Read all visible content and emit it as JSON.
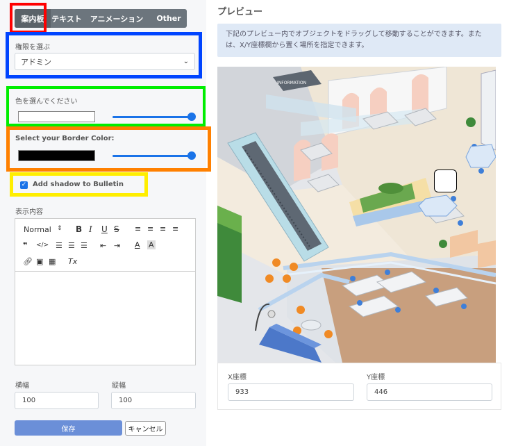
{
  "tabs": [
    {
      "label": "案内板",
      "active": true
    },
    {
      "label": "テキスト",
      "active": false
    },
    {
      "label": "アニメーション",
      "active": false
    },
    {
      "label": "Other",
      "active": false
    }
  ],
  "permission": {
    "label": "権限を選ぶ",
    "value": "アドミン"
  },
  "color": {
    "label": "色を選んでください",
    "value": "#ffffff",
    "slider": 1.0
  },
  "border_color": {
    "label": "Select your Border Color:",
    "value": "#000000",
    "slider": 1.0
  },
  "shadow": {
    "label": "Add shadow to Bulletin",
    "checked": true
  },
  "content": {
    "label": "表示内容",
    "toolbar": {
      "format": "Normal",
      "format_arrow": "⇕",
      "bold": "B",
      "italic": "I",
      "underline": "U",
      "strike": "S",
      "quote": "❞",
      "code": "</>",
      "clear": "Tx"
    },
    "body": ""
  },
  "width": {
    "label": "横幅",
    "value": "100"
  },
  "height": {
    "label": "縦幅",
    "value": "100"
  },
  "save_label": "保存",
  "cancel_label": "キャンセル",
  "preview": {
    "title": "プレビュー",
    "info": "下記のプレビュー内でオブジェクトをドラッグして移動することができます。または、X/Y座標欄から置く場所を指定できます。",
    "sign_text": "INFORMATION"
  },
  "x_coord": {
    "label": "X座標",
    "value": "933"
  },
  "y_coord": {
    "label": "Y座標",
    "value": "446"
  },
  "highlight_colors": {
    "red": "#ff0000",
    "blue": "#0044ff",
    "green": "#00ee00",
    "orange": "#ff8000",
    "yellow": "#ffee00"
  },
  "accent": "#1a73e8",
  "save_color": "#6b8fd8"
}
